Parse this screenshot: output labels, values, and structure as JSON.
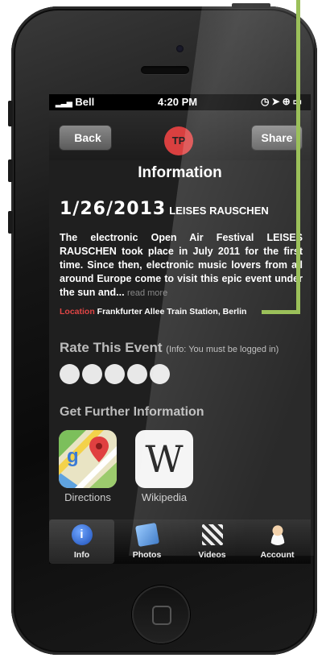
{
  "status_bar": {
    "carrier": "Bell",
    "time": "4:20 PM"
  },
  "nav": {
    "back_label": "Back",
    "share_label": "Share",
    "logo_text": "TP",
    "title": "Information"
  },
  "event": {
    "date": "1/26/2013",
    "name": "LEISES RAUSCHEN",
    "description": "The electronic Open Air Festival LEISES RAUSCHEN took place in July 2011 for the first time. Since then, electronic music lovers from all around Europe come to visit this epic event under the sun and...",
    "read_more": "read more",
    "location_label": "Location",
    "location_value": "Frankfurter Allee Train Station, Berlin"
  },
  "rating": {
    "title": "Rate This Event",
    "info": "(Info: You must be logged in)",
    "max": 5,
    "value": 0
  },
  "further": {
    "title": "Get Further Information",
    "apps": [
      {
        "label": "Directions",
        "icon": "maps-icon"
      },
      {
        "label": "Wikipedia",
        "icon": "wikipedia-icon",
        "glyph": "W"
      }
    ]
  },
  "tabs": [
    {
      "label": "Info",
      "icon": "info-icon"
    },
    {
      "label": "Photos",
      "icon": "photos-icon"
    },
    {
      "label": "Videos",
      "icon": "clapperboard-icon"
    },
    {
      "label": "Account",
      "icon": "person-icon"
    }
  ],
  "colors": {
    "callout": "#9bc05a",
    "location_label": "#e04545",
    "logo": "#d94040"
  }
}
